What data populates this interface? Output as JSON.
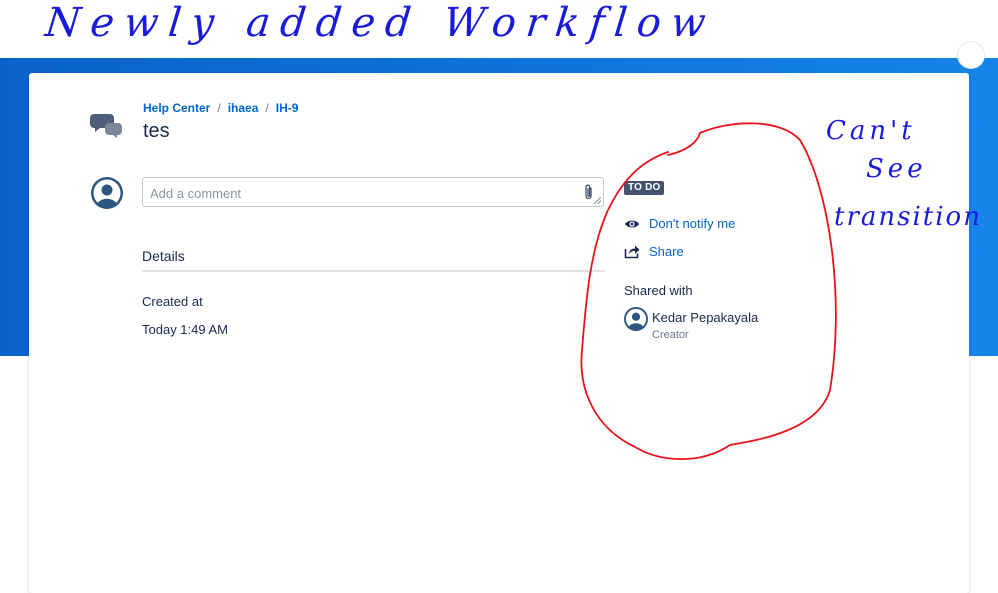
{
  "annotations": {
    "top": "Newly added Workflow",
    "right_line1": "Can't",
    "right_line2": "See",
    "right_line3": "transition"
  },
  "breadcrumb": {
    "items": [
      "Help Center",
      "ihaea",
      "IH-9"
    ],
    "separator": "/"
  },
  "request": {
    "title": "tes"
  },
  "comment": {
    "placeholder": "Add a comment",
    "value": ""
  },
  "details": {
    "heading": "Details",
    "created_label": "Created at",
    "created_value": "Today 1:49 AM"
  },
  "sidebar": {
    "status": "TO DO",
    "notify_label": "Don't notify me",
    "share_label": "Share",
    "shared_with_heading": "Shared with",
    "person_name": "Kedar Pepakayala",
    "person_role": "Creator"
  },
  "icons": {
    "help": "speech-bubbles-icon",
    "avatar": "user-avatar-icon",
    "attach": "paperclip-icon",
    "watch": "eye-icon",
    "share": "share-icon"
  },
  "colors": {
    "banner": "#0d72d9",
    "link": "#0065cc",
    "badge": "#42526e",
    "ink_blue": "#1a1adb",
    "ink_red": "#e8141b"
  }
}
